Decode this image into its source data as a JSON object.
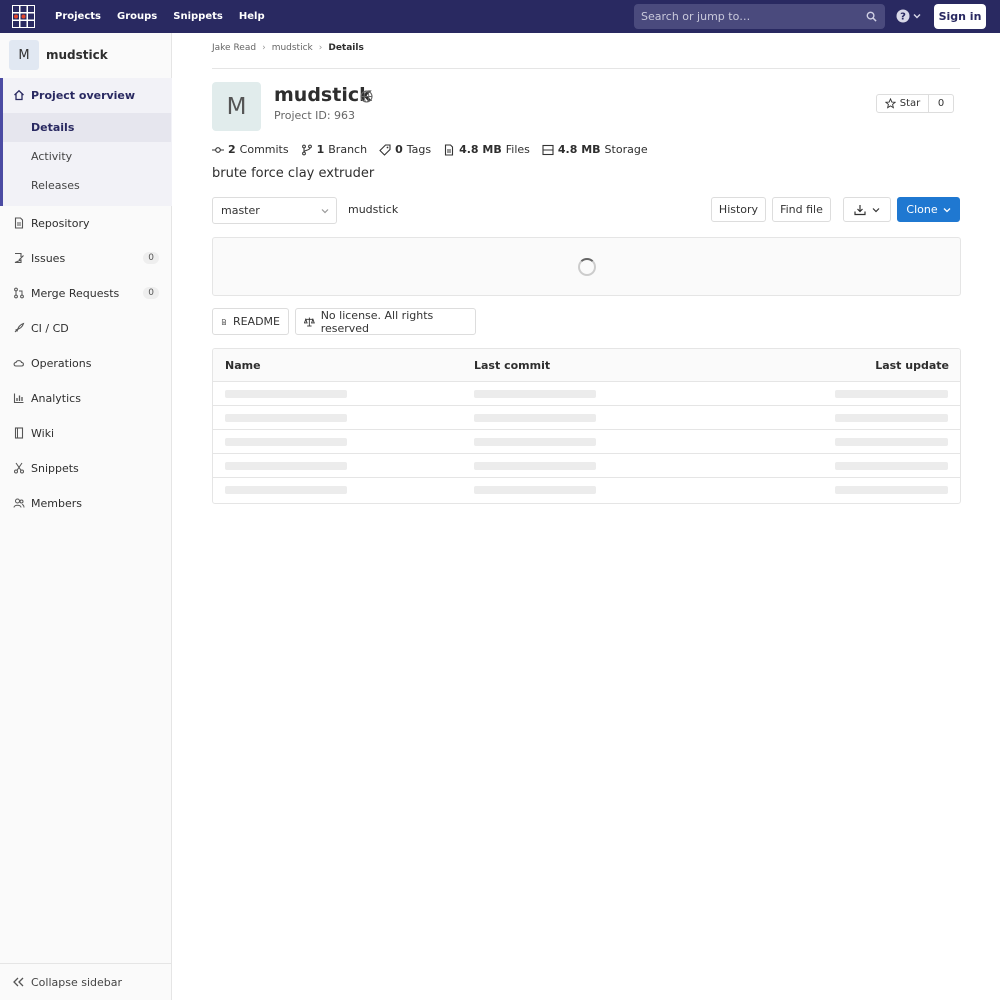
{
  "navbar": {
    "links": [
      "Projects",
      "Groups",
      "Snippets",
      "Help"
    ],
    "search_placeholder": "Search or jump to…",
    "sign_in": "Sign in"
  },
  "sidebar": {
    "avatar_letter": "M",
    "project_name": "mudstick",
    "overview": "Project overview",
    "sub_items": [
      "Details",
      "Activity",
      "Releases"
    ],
    "items": [
      {
        "label": "Repository",
        "icon": "doc-icon"
      },
      {
        "label": "Issues",
        "icon": "issues-icon",
        "count": "0"
      },
      {
        "label": "Merge Requests",
        "icon": "merge-icon",
        "count": "0"
      },
      {
        "label": "CI / CD",
        "icon": "rocket-icon"
      },
      {
        "label": "Operations",
        "icon": "cloud-icon"
      },
      {
        "label": "Analytics",
        "icon": "chart-icon"
      },
      {
        "label": "Wiki",
        "icon": "book-icon"
      },
      {
        "label": "Snippets",
        "icon": "scissors-icon"
      },
      {
        "label": "Members",
        "icon": "users-icon"
      }
    ],
    "collapse": "Collapse sidebar"
  },
  "breadcrumb": [
    "Jake Read",
    "mudstick",
    "Details"
  ],
  "project": {
    "avatar_letter": "M",
    "title": "mudstick",
    "id_text": "Project ID: 963",
    "star_label": "Star",
    "star_count": "0",
    "description": "brute force clay extruder"
  },
  "stats": {
    "commits_n": "2",
    "commits_label": "Commits",
    "branch_n": "1",
    "branch_label": "Branch",
    "tags_n": "0",
    "tags_label": "Tags",
    "files_n": "4.8 MB",
    "files_label": "Files",
    "storage_n": "4.8 MB",
    "storage_label": "Storage"
  },
  "repo": {
    "branch": "master",
    "path": "mudstick",
    "history": "History",
    "find_file": "Find file",
    "clone": "Clone",
    "readme": "README",
    "license": "No license. All rights reserved"
  },
  "table": {
    "headers": [
      "Name",
      "Last commit",
      "Last update"
    ]
  },
  "colors": {
    "navbar": "#292961",
    "accent": "#1f78d1",
    "sidebar_active": "#4b4ba3"
  }
}
